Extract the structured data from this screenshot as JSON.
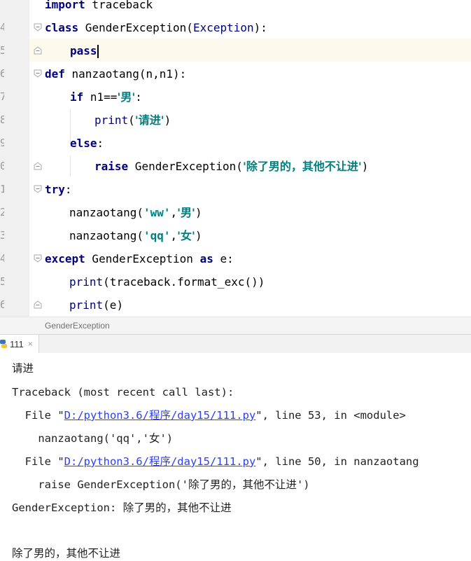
{
  "editor": {
    "line_numbers": [
      "4",
      "5",
      "6",
      "7",
      "8",
      "9",
      "0",
      "1",
      "2",
      "3",
      "4",
      "5",
      "6"
    ],
    "lines": {
      "l0": {
        "kw": "import",
        "rest": " traceback"
      },
      "l1": {
        "kw": "class",
        "name": " GenderException(",
        "base": "Exception",
        "end": "):"
      },
      "l2": {
        "kw": "pass"
      },
      "l3": {
        "kw": "def",
        "rest": " nanzaotang(n,n1):"
      },
      "l4": {
        "kw": "if",
        "rest": " n1==",
        "str": "'男'",
        "end": ":"
      },
      "l5": {
        "fn": "print",
        "open": "(",
        "str": "'请进'",
        "end": ")"
      },
      "l6": {
        "kw": "else",
        "end": ":"
      },
      "l7": {
        "kw": "raise",
        "rest": " GenderException(",
        "str": "'除了男的，其他不让进'",
        "end": ")"
      },
      "l8": {
        "kw": "try",
        "end": ":"
      },
      "l9": {
        "rest": "nanzaotang(",
        "s1": "'ww'",
        "mid": ",",
        "s2": "'男'",
        "end": ")"
      },
      "l10": {
        "rest": "nanzaotang(",
        "s1": "'qq'",
        "mid": ",",
        "s2": "'女'",
        "end": ")"
      },
      "l11": {
        "kw": "except",
        "rest": " GenderException ",
        "kw2": "as",
        "end": " e:"
      },
      "l12": {
        "fn": "print",
        "rest": "(traceback.format_exc())"
      },
      "l13": {
        "fn": "print",
        "rest": "(e)"
      }
    }
  },
  "breadcrumb": {
    "label": "GenderException"
  },
  "run_tab": {
    "label": "111",
    "close": "×"
  },
  "console": {
    "line1": "请进",
    "line2": "Traceback (most recent call last):",
    "line3": {
      "pre": "  File \"",
      "link": "D:/python3.6/程序/day15/111.py",
      "post": "\", line 53, in <module>"
    },
    "line4": "    nanzaotang('qq','女')",
    "line5": {
      "pre": "  File \"",
      "link": "D:/python3.6/程序/day15/111.py",
      "post": "\", line 50, in nanzaotang"
    },
    "line6": "    raise GenderException('除了男的，其他不让进')",
    "line7": "GenderException: 除了男的，其他不让进",
    "line8": "除了男的，其他不让进"
  }
}
